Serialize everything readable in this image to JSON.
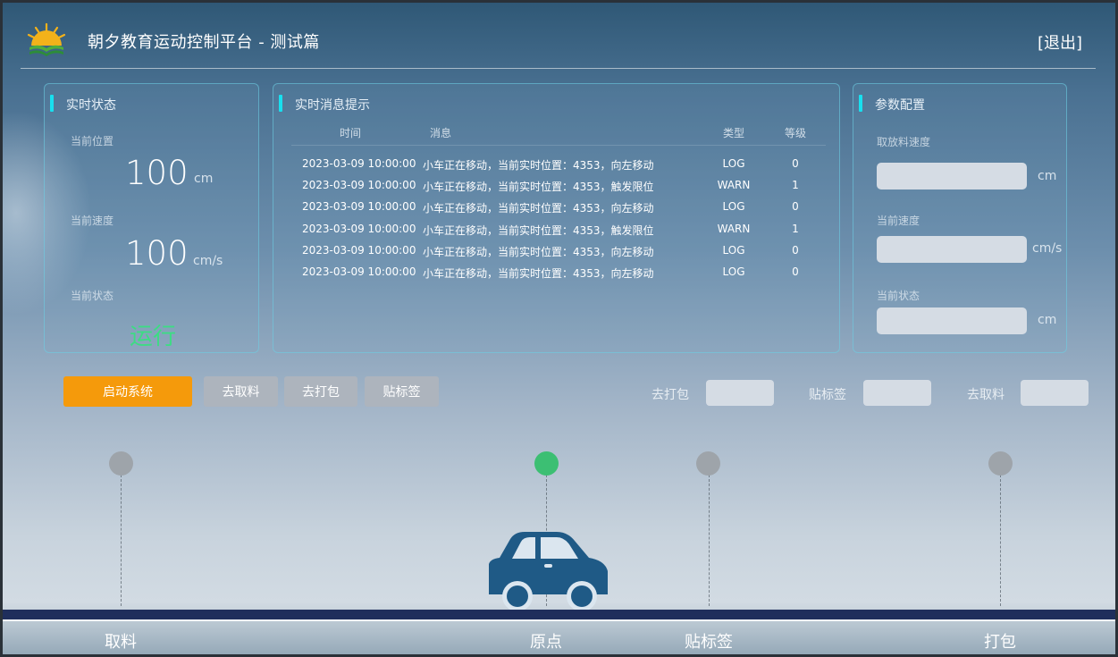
{
  "header": {
    "title": "朝夕教育运动控制平台 - 测试篇",
    "exit_label": "[退出]"
  },
  "status_panel": {
    "title": "实时状态",
    "position_label": "当前位置",
    "position_value": "100",
    "position_unit": "cm",
    "speed_label": "当前速度",
    "speed_value": "100",
    "speed_unit": "cm/s",
    "state_label": "当前状态",
    "state_value": "运行"
  },
  "message_panel": {
    "title": "实时消息提示",
    "columns": [
      "时间",
      "消息",
      "类型",
      "等级"
    ],
    "rows": [
      {
        "time": "2023-03-09 10:00:00",
        "message": "小车正在移动，当前实时位置：4353，向左移动",
        "type": "LOG",
        "level": "0"
      },
      {
        "time": "2023-03-09 10:00:00",
        "message": "小车正在移动，当前实时位置：4353，触发限位",
        "type": "WARN",
        "level": "1"
      },
      {
        "time": "2023-03-09 10:00:00",
        "message": "小车正在移动，当前实时位置：4353，向左移动",
        "type": "LOG",
        "level": "0"
      },
      {
        "time": "2023-03-09 10:00:00",
        "message": "小车正在移动，当前实时位置：4353，触发限位",
        "type": "WARN",
        "level": "1"
      },
      {
        "time": "2023-03-09 10:00:00",
        "message": "小车正在移动，当前实时位置：4353，向左移动",
        "type": "LOG",
        "level": "0"
      },
      {
        "time": "2023-03-09 10:00:00",
        "message": "小车正在移动，当前实时位置：4353，向左移动",
        "type": "LOG",
        "level": "0"
      }
    ]
  },
  "config_panel": {
    "title": "参数配置",
    "field1_label": "取放料速度",
    "field1_unit": "cm",
    "field1_value": "",
    "field2_label": "当前速度",
    "field2_unit": "cm/s",
    "field2_value": "",
    "field3_label": "当前状态",
    "field3_unit": "cm",
    "field3_value": ""
  },
  "controls": {
    "start_label": "启动系统",
    "go_pick_label": "去取料",
    "go_pack_label": "去打包",
    "label_label": "贴标签",
    "pack_field_label": "去打包",
    "label_field_label": "贴标签",
    "pick_field_label": "去取料"
  },
  "stations": {
    "pick": "取料",
    "origin": "原点",
    "label": "贴标签",
    "pack": "打包",
    "active": "origin"
  },
  "colors": {
    "accent_cyan": "#18e0ef",
    "start_button": "#f59a0b",
    "running_green": "#3ddc84",
    "active_dot": "#3cbf73",
    "car": "#1f5a86",
    "track": "#1f2e5c"
  }
}
